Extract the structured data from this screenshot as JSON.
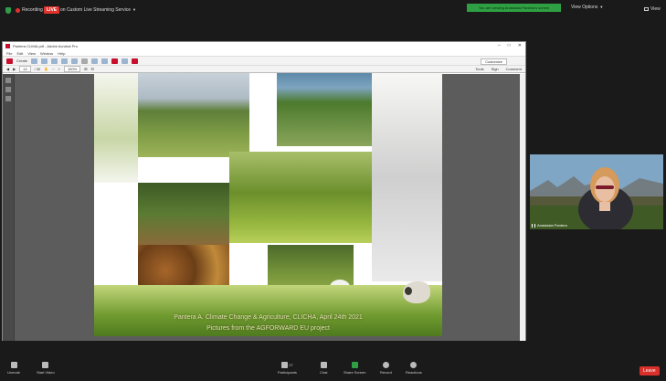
{
  "topbar": {
    "recording": "Recording",
    "live_badge": "LIVE",
    "live_status": "on Custom Live Streaming Service",
    "viewing_banner": "You are viewing Anastasia Pantera's screen",
    "view_options": "View Options",
    "view": "View"
  },
  "window": {
    "title": "Pantera CLIMA.pdf - Adobe Acrobat Pro",
    "menu": [
      "File",
      "Edit",
      "View",
      "Window",
      "Help"
    ],
    "create": "Create",
    "customize": "Customize",
    "page_num": "13",
    "page_total": "/ 30",
    "zoom": "100%",
    "tools": [
      "Tools",
      "Sign",
      "Comment"
    ]
  },
  "slide": {
    "caption_line1": "Pantera A. Climate Change & Agriculture, CLICHA, April 24th 2021",
    "caption_line2": "Pictures from the AGFORWARD EU project"
  },
  "video": {
    "participant_name": "Anastasia Pantera"
  },
  "bottombar": {
    "unmute": "Unmute",
    "start_video": "Start Video",
    "participants": "Participants",
    "participants_count": "27",
    "chat": "Chat",
    "share_screen": "Share Screen",
    "record": "Record",
    "reactions": "Reactions",
    "leave": "Leave"
  },
  "colors": {
    "live_red": "#e0332d",
    "viewing_green": "#2ea043",
    "leave_red": "#d9302c"
  }
}
